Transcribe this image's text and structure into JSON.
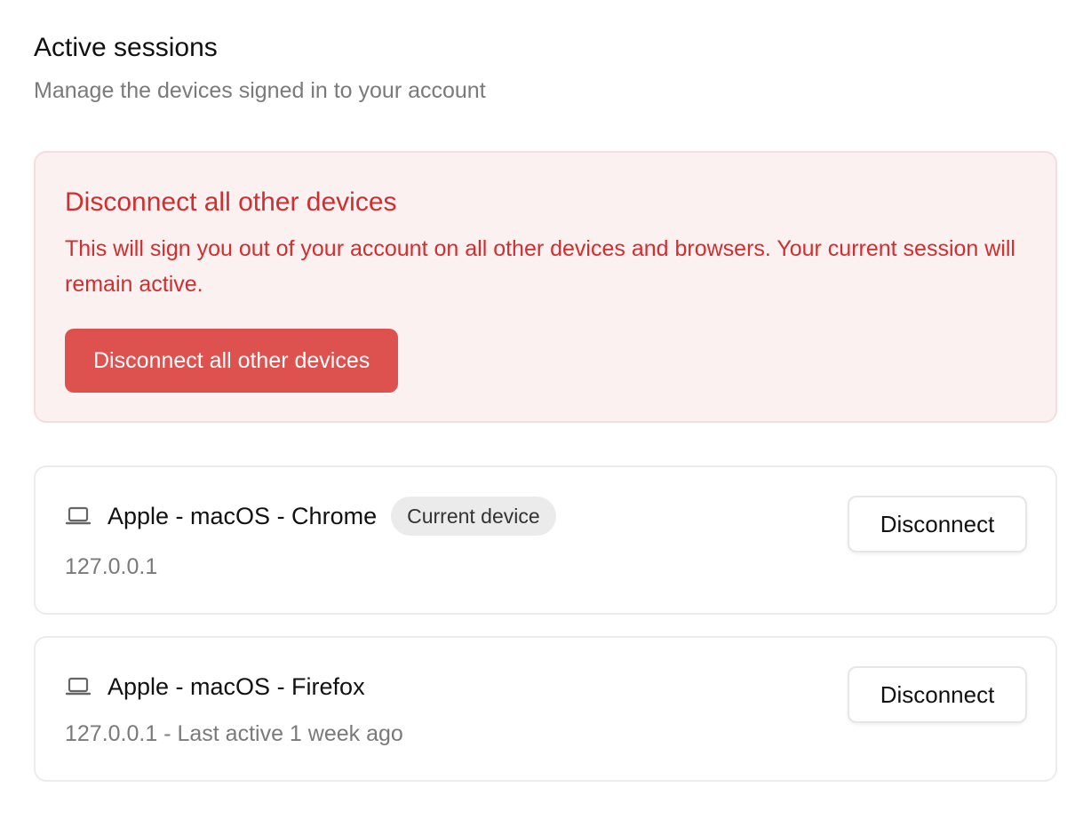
{
  "header": {
    "title": "Active sessions",
    "subtitle": "Manage the devices signed in to your account"
  },
  "danger": {
    "title": "Disconnect all other devices",
    "description": "This will sign you out of your account on all other devices and browsers. Your current session will remain active.",
    "button_label": "Disconnect all other devices",
    "colors": {
      "text": "#d02f2f",
      "background": "#fcf1f1",
      "button": "#dd524f"
    }
  },
  "sessions": [
    {
      "icon": "laptop-icon",
      "device": "Apple - macOS - Chrome",
      "badge": "Current device",
      "meta": "127.0.0.1",
      "button_label": "Disconnect"
    },
    {
      "icon": "laptop-icon",
      "device": "Apple - macOS - Firefox",
      "meta": "127.0.0.1 - Last active 1 week ago",
      "button_label": "Disconnect"
    }
  ]
}
